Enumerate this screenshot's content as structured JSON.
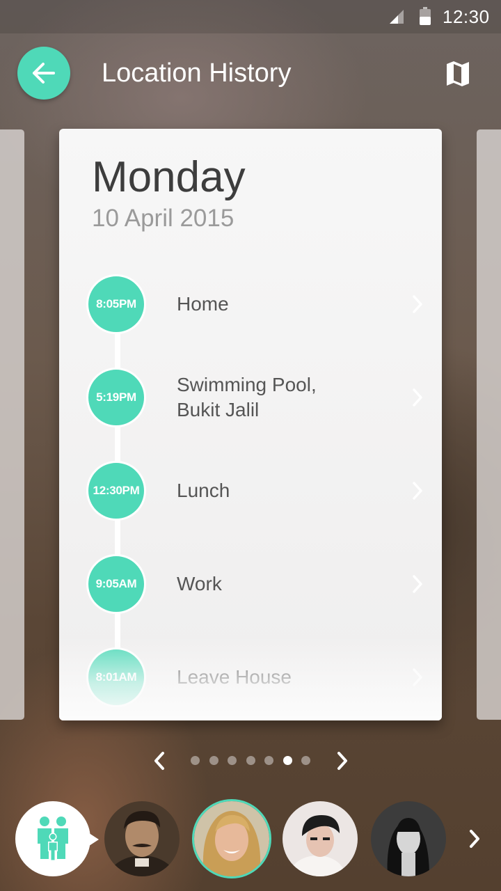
{
  "status_bar": {
    "time": "12:30",
    "icons": [
      "signal-icon",
      "battery-icon"
    ]
  },
  "app_bar": {
    "title": "Location History",
    "back_icon": "arrow-left-icon",
    "map_icon": "map-icon"
  },
  "day": {
    "name": "Monday",
    "date": "10 April 2015"
  },
  "timeline": [
    {
      "time": "8:05PM",
      "place": "Home"
    },
    {
      "time": "5:19PM",
      "place": "Swimming Pool,\nBukit Jalil"
    },
    {
      "time": "12:30PM",
      "place": "Lunch"
    },
    {
      "time": "9:05AM",
      "place": "Work"
    },
    {
      "time": "8:01AM",
      "place": "Leave House"
    }
  ],
  "pager": {
    "total": 7,
    "active_index": 5
  },
  "people": {
    "family_icon": "family-icon",
    "selected_index": 1,
    "count": 4
  },
  "colors": {
    "accent": "#4fd9b8",
    "card": "#f3f3f3",
    "title_text": "#3d3d3d",
    "subtitle_text": "#9a9a9a"
  }
}
